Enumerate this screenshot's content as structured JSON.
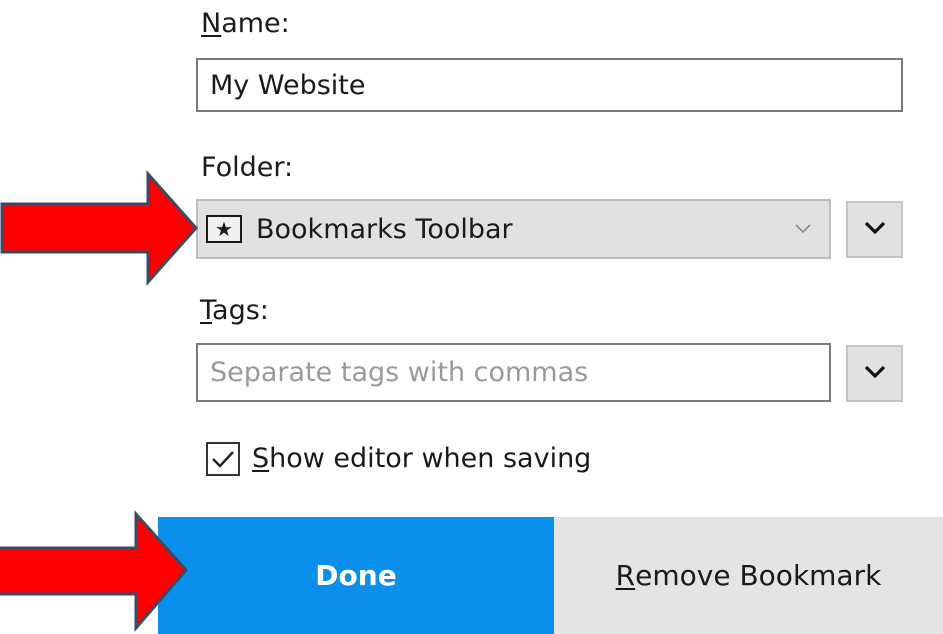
{
  "name_field": {
    "label_first": "N",
    "label_rest": "ame:",
    "value": "My Website"
  },
  "folder": {
    "label": "Folder:",
    "selected": "Bookmarks Toolbar",
    "icon": "star-icon"
  },
  "tags": {
    "label_first": "T",
    "label_rest": "ags:",
    "placeholder": "Separate tags with commas"
  },
  "show_editor": {
    "label_first": "S",
    "label_rest": "how editor when saving",
    "checked": true
  },
  "buttons": {
    "done": "Done",
    "remove_first": "R",
    "remove_rest": "emove Bookmark"
  },
  "annotations": {
    "arrow_color": "#ff0000",
    "arrow_targets": [
      "folder-select",
      "done-button"
    ]
  },
  "colors": {
    "accent": "#0a8fed",
    "secondary_button": "#e4e4e4"
  }
}
